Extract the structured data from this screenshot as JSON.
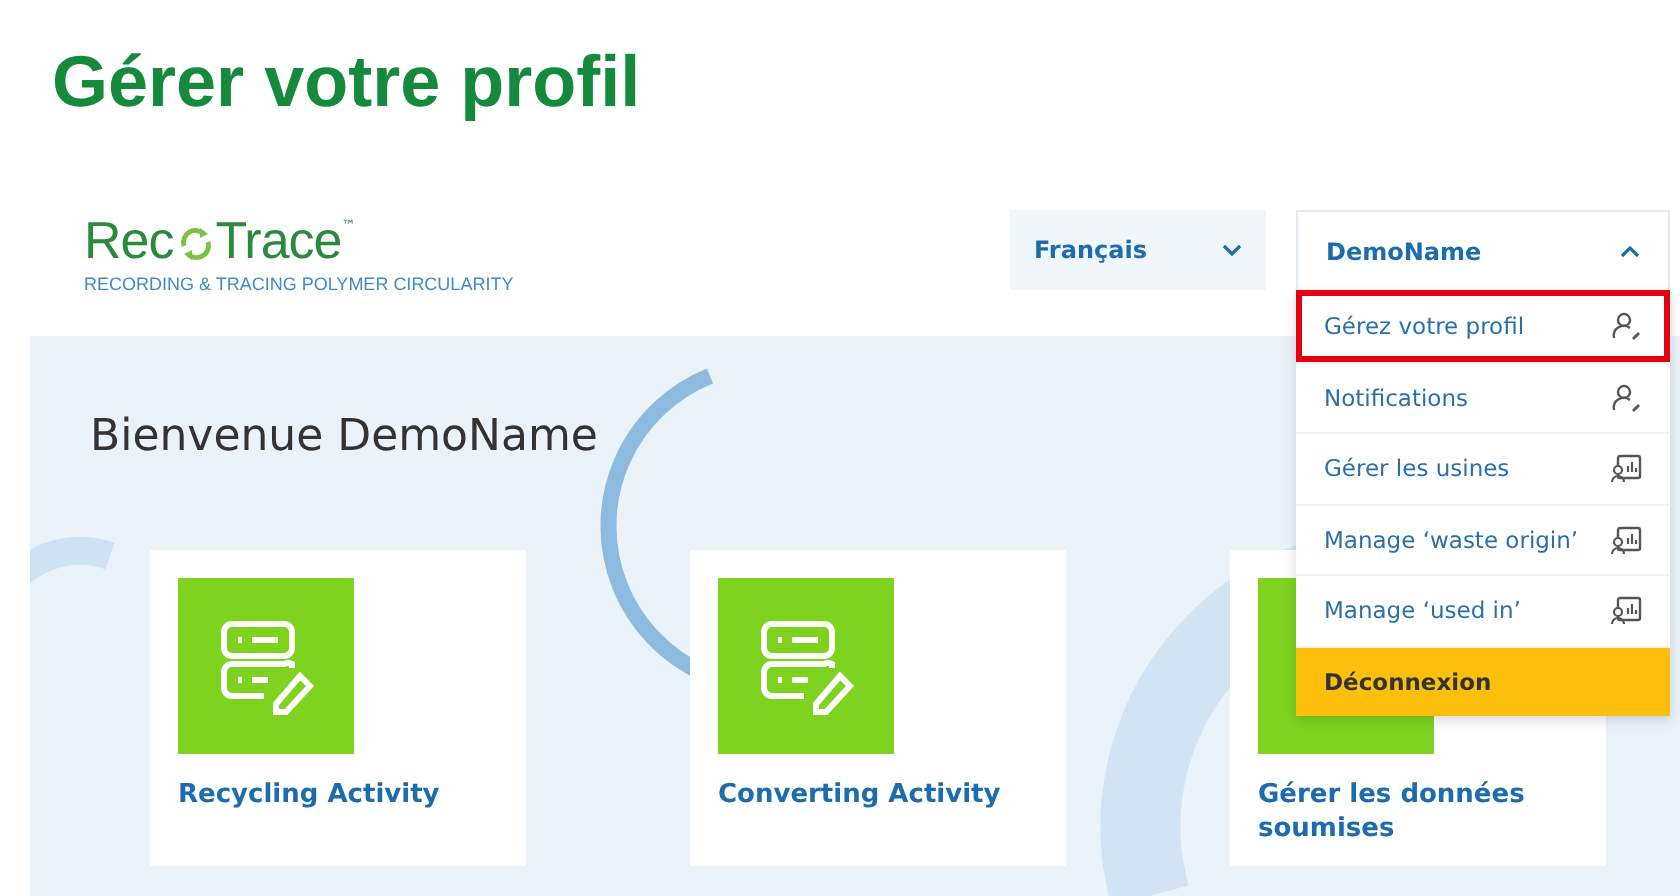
{
  "slide_title": "Gérer votre profil",
  "logo": {
    "name_start": "Rec",
    "name_end": "Trace",
    "trademark": "™",
    "tagline": "RECORDING & TRACING POLYMER CIRCULARITY"
  },
  "language_select": {
    "value": "Français",
    "expanded": false
  },
  "user_menu": {
    "name": "DemoName",
    "expanded": true,
    "items": [
      {
        "label": "Gérez votre profil",
        "kind": "profile",
        "highlighted": true
      },
      {
        "label": "Notifications",
        "kind": "profile",
        "highlighted": false
      },
      {
        "label": "Gérer les usines",
        "kind": "chart",
        "highlighted": false
      },
      {
        "label": "Manage ‘waste origin’",
        "kind": "chart",
        "highlighted": false
      },
      {
        "label": "Manage ‘used in’",
        "kind": "chart",
        "highlighted": false
      },
      {
        "label": "Déconnexion",
        "kind": "logout",
        "highlighted": false
      }
    ]
  },
  "welcome": "Bienvenue DemoName",
  "cards": [
    {
      "title": "Recycling Activity"
    },
    {
      "title": "Converting Activity"
    },
    {
      "title": "Gérer les données soumises"
    }
  ]
}
